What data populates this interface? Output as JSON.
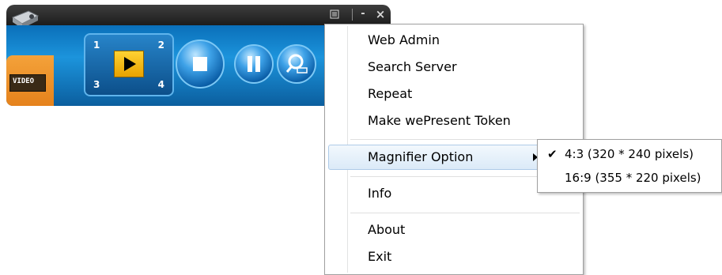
{
  "player": {
    "title_controls": {
      "menu_icon": "list-icon",
      "minimize": "-",
      "close": "×"
    },
    "video_badge": "VIDEO",
    "quad_numbers": [
      "1",
      "2",
      "3",
      "4"
    ],
    "buttons": [
      "play-icon",
      "stop-icon",
      "pause-icon",
      "magnifier-icon"
    ]
  },
  "menu": {
    "items": [
      {
        "label": "Web Admin"
      },
      {
        "label": "Search Server"
      },
      {
        "label": "Repeat"
      },
      {
        "label": "Make wePresent Token"
      },
      {
        "label": "Magnifier Option",
        "has_submenu": true,
        "highlighted": true
      },
      {
        "label": "Info"
      },
      {
        "label": "About"
      },
      {
        "label": "Exit"
      }
    ]
  },
  "submenu": {
    "items": [
      {
        "label": "4:3 (320 * 240 pixels)",
        "checked": true,
        "check_mark": "✔"
      },
      {
        "label": "16:9 (355 * 220 pixels)",
        "checked": false
      }
    ]
  }
}
